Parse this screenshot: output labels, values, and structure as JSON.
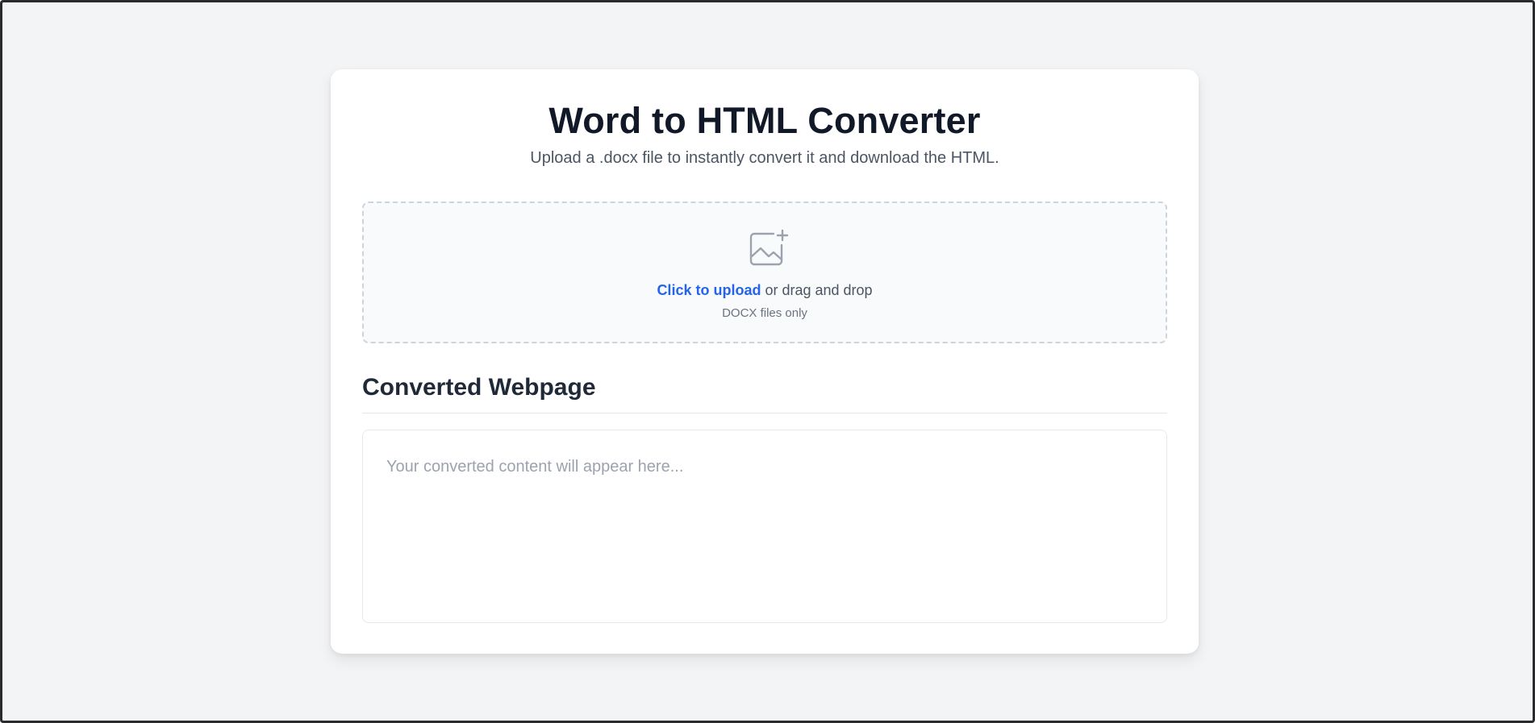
{
  "app": {
    "title": "Word to HTML Converter",
    "subtitle": "Upload a .docx file to instantly convert it and download the HTML."
  },
  "upload": {
    "icon": "image-add-icon",
    "link_label": "Click to upload",
    "suffix": " or drag and drop",
    "hint": "DOCX files only"
  },
  "output": {
    "heading": "Converted Webpage",
    "placeholder": "Your converted content will appear here..."
  },
  "colors": {
    "background": "#f3f4f6",
    "accent": "#2563eb",
    "title": "#111827",
    "muted": "#6b7280"
  }
}
